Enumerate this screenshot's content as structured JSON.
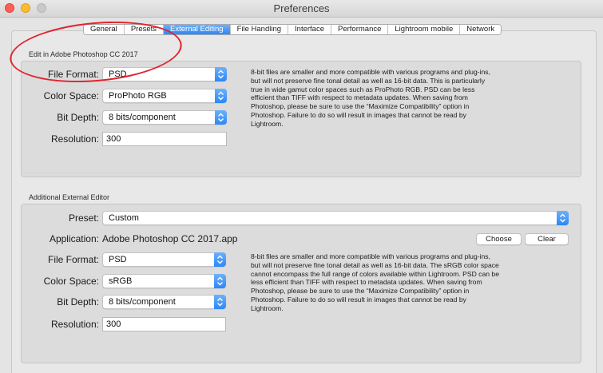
{
  "window": {
    "title": "Preferences"
  },
  "tabs": [
    {
      "label": "General",
      "active": false
    },
    {
      "label": "Presets",
      "active": false
    },
    {
      "label": "External Editing",
      "active": true
    },
    {
      "label": "File Handling",
      "active": false
    },
    {
      "label": "Interface",
      "active": false
    },
    {
      "label": "Performance",
      "active": false
    },
    {
      "label": "Lightroom mobile",
      "active": false
    },
    {
      "label": "Network",
      "active": false
    }
  ],
  "photoshop_section": {
    "title": "Edit in Adobe Photoshop CC 2017",
    "file_format_label": "File Format:",
    "file_format_value": "PSD",
    "color_space_label": "Color Space:",
    "color_space_value": "ProPhoto RGB",
    "bit_depth_label": "Bit Depth:",
    "bit_depth_value": "8 bits/component",
    "resolution_label": "Resolution:",
    "resolution_value": "300",
    "description": "8-bit files are smaller and more compatible with various programs and plug-ins, but will not preserve fine tonal detail as well as 16-bit data. This is particularly true in wide gamut color spaces such as ProPhoto RGB. PSD can be less efficient than TIFF with respect to metadata updates. When saving from Photoshop, please be sure to use the “Maximize Compatibility” option in Photoshop. Failure to do so will result in images that cannot be read by Lightroom."
  },
  "additional_section": {
    "title": "Additional External Editor",
    "preset_label": "Preset:",
    "preset_value": "Custom",
    "application_label": "Application:",
    "application_value": "Adobe Photoshop CC 2017.app",
    "choose_label": "Choose",
    "clear_label": "Clear",
    "file_format_label": "File Format:",
    "file_format_value": "PSD",
    "color_space_label": "Color Space:",
    "color_space_value": "sRGB",
    "bit_depth_label": "Bit Depth:",
    "bit_depth_value": "8 bits/component",
    "resolution_label": "Resolution:",
    "resolution_value": "300",
    "description": "8-bit files are smaller and more compatible with various programs and plug-ins, but will not preserve fine tonal detail as well as 16-bit data. The sRGB color space cannot encompass the full range of colors available within Lightroom. PSD can be less efficient than TIFF with respect to metadata updates. When saving from Photoshop, please be sure to use the “Maximize Compatibility” option in Photoshop. Failure to do so will result in images that cannot be read by Lightroom."
  },
  "colors": {
    "accent": "#2d87f5",
    "annotation": "#e0242e"
  }
}
